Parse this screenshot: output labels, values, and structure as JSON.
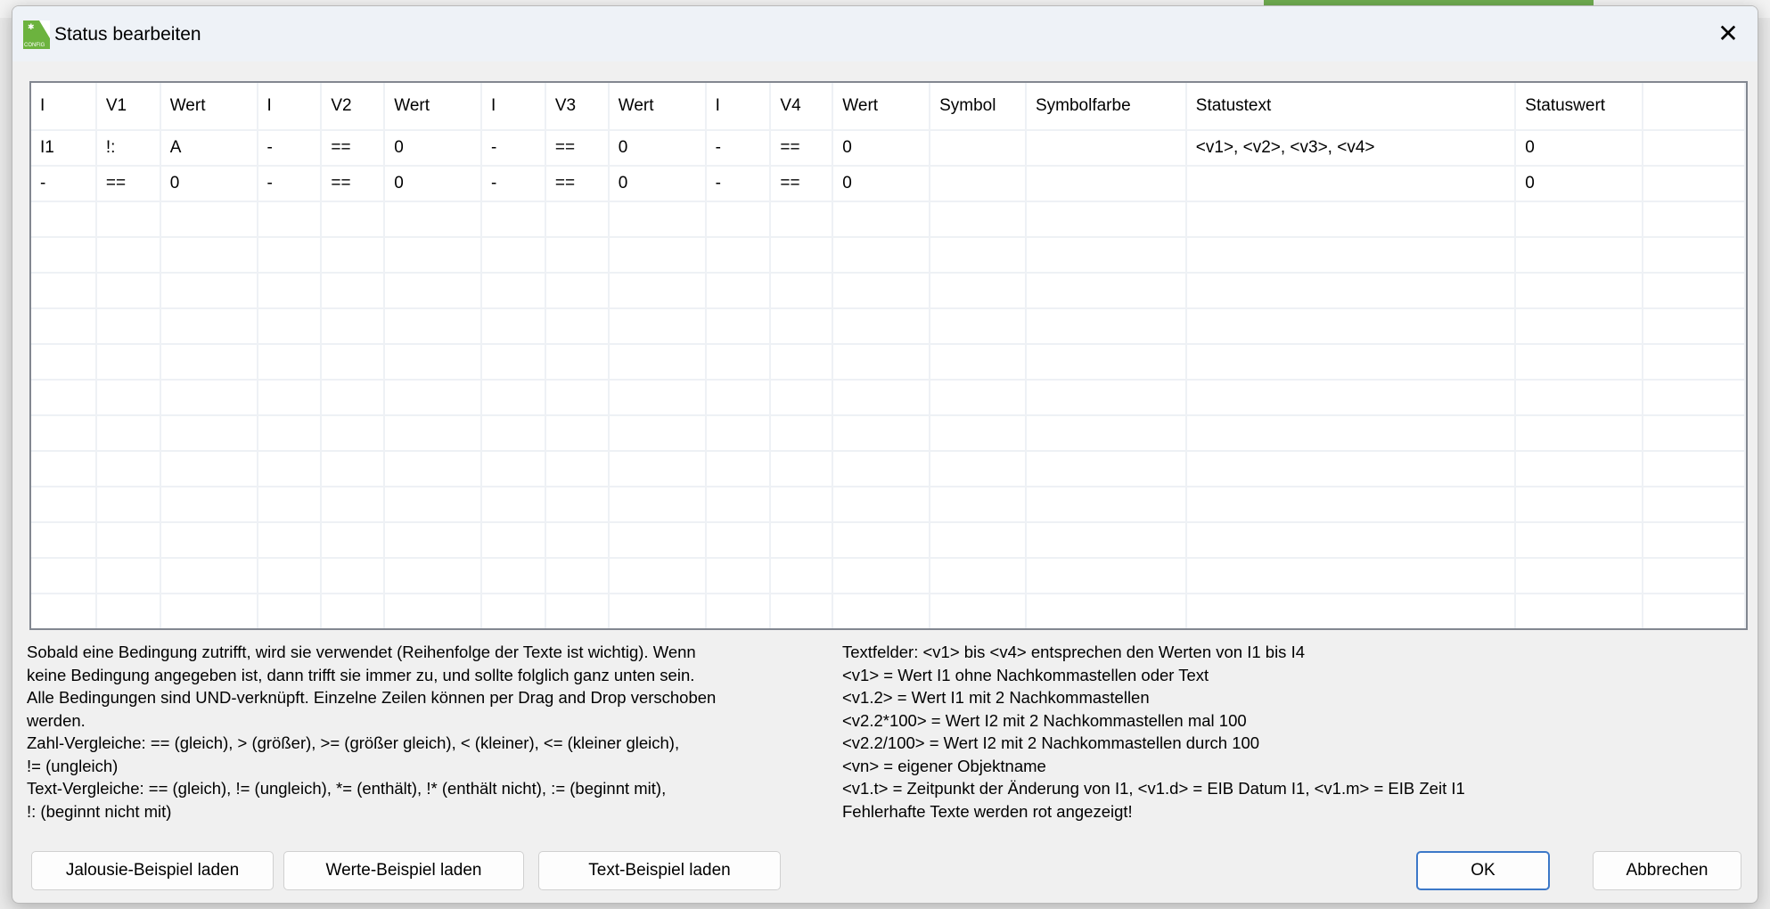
{
  "dialog": {
    "title": "Status bearbeiten",
    "icon": "config-app-icon",
    "icon_label": "CONFIG"
  },
  "grid": {
    "columns": [
      "I",
      "V1",
      "Wert",
      "I",
      "V2",
      "Wert",
      "I",
      "V3",
      "Wert",
      "I",
      "V4",
      "Wert",
      "Symbol",
      "Symbolfarbe",
      "Statustext",
      "Statuswert",
      ""
    ],
    "rows": [
      [
        "I1",
        "!:",
        "A",
        "-",
        "==",
        "0",
        "-",
        "==",
        "0",
        "-",
        "==",
        "0",
        "",
        "",
        "<v1>, <v2>, <v3>, <v4>",
        "0",
        ""
      ],
      [
        "-",
        "==",
        "0",
        "-",
        "==",
        "0",
        "-",
        "==",
        "0",
        "-",
        "==",
        "0",
        "",
        "",
        "",
        "0",
        ""
      ]
    ]
  },
  "help_left": [
    "Sobald eine Bedingung zutrifft, wird sie verwendet (Reihenfolge der Texte ist wichtig). Wenn",
    "keine Bedingung angegeben ist, dann trifft sie immer zu, und sollte folglich ganz unten sein.",
    "Alle Bedingungen sind UND-verknüpft. Einzelne Zeilen können per Drag and Drop verschoben",
    "werden.",
    "Zahl-Vergleiche: == (gleich), > (größer), >= (größer gleich), < (kleiner), <= (kleiner gleich),",
    "!= (ungleich)",
    "Text-Vergleiche: == (gleich), != (ungleich), *= (enthält), !* (enthält nicht), := (beginnt mit),",
    "!: (beginnt nicht mit)"
  ],
  "help_right": [
    "Textfelder: <v1> bis <v4> entsprechen den Werten von I1 bis I4",
    "<v1> = Wert I1 ohne Nachkommastellen oder Text",
    "<v1.2> = Wert I1 mit 2 Nachkommastellen",
    "<v2.2*100> = Wert I2 mit 2 Nachkommastellen mal 100",
    "<v2.2/100> = Wert I2 mit 2 Nachkommastellen durch 100",
    "<vn> = eigener Objektname",
    "<v1.t> = Zeitpunkt der Änderung von I1, <v1.d> = EIB Datum I1, <v1.m> = EIB Zeit I1",
    "Fehlerhafte Texte werden rot angezeigt!"
  ],
  "buttons": {
    "jalousie": "Jalousie-Beispiel laden",
    "werte": "Werte-Beispiel laden",
    "text": "Text-Beispiel laden",
    "ok": "OK",
    "cancel": "Abbrechen"
  },
  "colors": {
    "accent": "#3c78c8",
    "icon_green": "#6cb33e"
  }
}
